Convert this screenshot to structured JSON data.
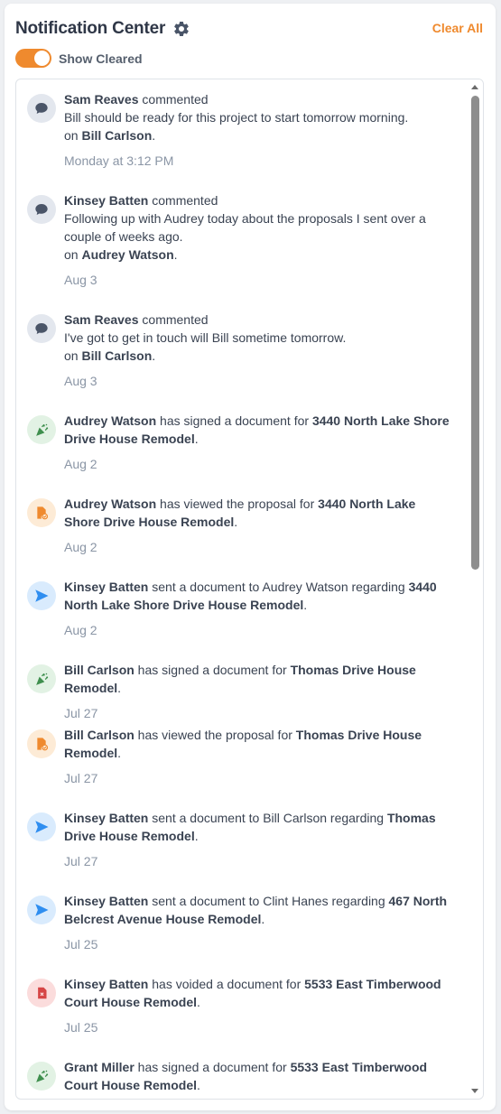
{
  "header": {
    "title": "Notification Center",
    "settings_icon": "gear-icon",
    "clear_all_label": "Clear All"
  },
  "toggle": {
    "label": "Show Cleared",
    "on": true
  },
  "colors": {
    "accent": "#ef8a2e",
    "comment_icon": "#4a5568",
    "signed_icon": "#3f8f4e",
    "viewed_icon": "#ef8a2e",
    "sent_icon": "#2f8ef0",
    "voided_icon": "#d64545"
  },
  "notifications": [
    {
      "type": "comment",
      "icon": "comment-icon",
      "actor": "Sam Reaves",
      "action": " commented",
      "message": "Bill should be ready for this project to start tomorrow morning.",
      "on_prefix": "on ",
      "target": "Bill Carlson",
      "suffix": ".",
      "date": "Monday at 3:12 PM"
    },
    {
      "type": "comment",
      "icon": "comment-icon",
      "actor": "Kinsey Batten",
      "action": " commented",
      "message": "Following up with Audrey today about the proposals I sent over a couple of weeks ago.",
      "on_prefix": "on ",
      "target": "Audrey Watson",
      "suffix": ".",
      "date": "Aug 3"
    },
    {
      "type": "comment",
      "icon": "comment-icon",
      "actor": "Sam Reaves",
      "action": " commented",
      "message": "I've got to get in touch will Bill sometime tomorrow.",
      "on_prefix": "on ",
      "target": "Bill Carlson",
      "suffix": ".",
      "date": "Aug 3"
    },
    {
      "type": "signed",
      "icon": "party-popper-icon",
      "actor": "Audrey Watson",
      "action": " has signed a document for ",
      "target": "3440 North Lake Shore Drive House Remodel",
      "suffix": ".",
      "date": "Aug 2"
    },
    {
      "type": "viewed",
      "icon": "document-viewed-icon",
      "actor": "Audrey Watson",
      "action": " has viewed the proposal for ",
      "target": "3440 North Lake Shore Drive House Remodel",
      "suffix": ".",
      "date": "Aug 2"
    },
    {
      "type": "sent",
      "icon": "send-icon",
      "actor": "Kinsey Batten",
      "action": " sent a document to Audrey Watson regarding ",
      "target": "3440 North Lake Shore Drive House Remodel",
      "suffix": ".",
      "date": "Aug 2"
    },
    {
      "type": "signed",
      "icon": "party-popper-icon",
      "actor": "Bill Carlson",
      "action": " has signed a document for ",
      "target": "Thomas Drive House Remodel",
      "suffix": ".",
      "date": "Jul 27"
    },
    {
      "type": "viewed",
      "icon": "document-viewed-icon",
      "actor": "Bill Carlson",
      "action": " has viewed the proposal for ",
      "target": "Thomas Drive House Remodel",
      "suffix": ".",
      "date": "Jul 27"
    },
    {
      "type": "sent",
      "icon": "send-icon",
      "actor": "Kinsey Batten",
      "action": " sent a document to Bill Carlson regarding ",
      "target": "Thomas Drive House Remodel",
      "suffix": ".",
      "date": "Jul 27"
    },
    {
      "type": "sent",
      "icon": "send-icon",
      "actor": "Kinsey Batten",
      "action": " sent a document to Clint Hanes regarding ",
      "target": "467 North Belcrest Avenue House Remodel",
      "suffix": ".",
      "date": "Jul 25"
    },
    {
      "type": "voided",
      "icon": "document-voided-icon",
      "actor": "Kinsey Batten",
      "action": " has voided a document for ",
      "target": "5533 East Timberwood Court House Remodel",
      "suffix": ".",
      "date": "Jul 25"
    },
    {
      "type": "signed",
      "icon": "party-popper-icon",
      "actor": "Grant Miller",
      "action": " has signed a document for ",
      "target": "5533 East Timberwood Court House Remodel",
      "suffix": ".",
      "date": ""
    }
  ],
  "scrollbar": {
    "position_fraction": 0.0,
    "visible_fraction": 0.48
  }
}
